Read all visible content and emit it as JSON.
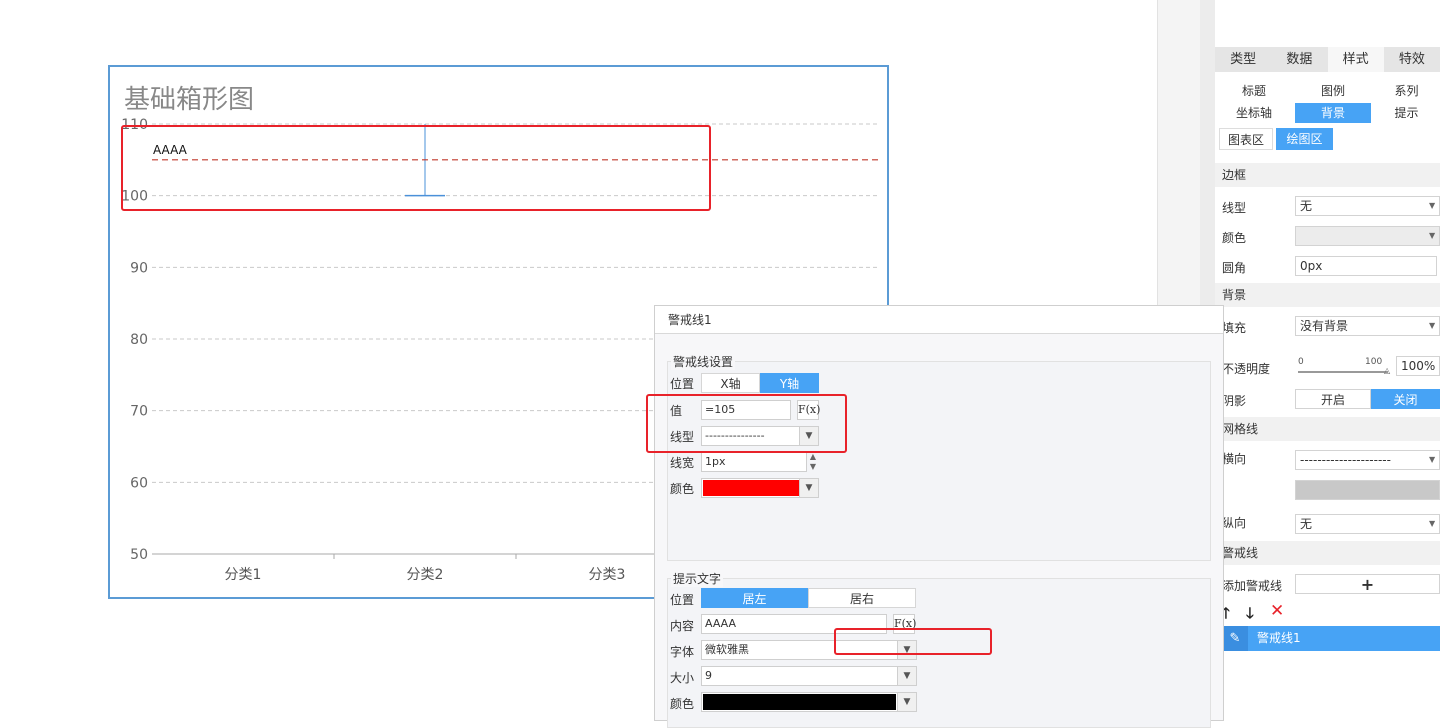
{
  "chart": {
    "title": "基础箱形图",
    "warning_label": "AAAA"
  },
  "chart_data": {
    "type": "box",
    "title": "基础箱形图",
    "categories": [
      "分类1",
      "分类2",
      "分类3"
    ],
    "y_ticks": [
      "110",
      "100",
      "90",
      "80",
      "70",
      "60",
      "50"
    ],
    "ylim": [
      50,
      110
    ],
    "grid": "horizontal-dashed",
    "series": [
      {
        "category": "分类2",
        "whisker_low": 100,
        "whisker_high": 110
      }
    ],
    "warning_line": {
      "value": 105,
      "label": "AAAA",
      "color": "#c0392b",
      "style": "dashed"
    }
  },
  "panel": {
    "main_tabs": [
      "类型",
      "数据",
      "样式",
      "特效"
    ],
    "sub_tabs_row1": [
      "标题",
      "图例",
      "系列"
    ],
    "sub_tabs_row2": [
      "坐标轴",
      "背景",
      "提示"
    ],
    "area_tabs": [
      "图表区",
      "绘图区"
    ],
    "border_section": "边框",
    "line_type_label": "线型",
    "line_type_value": "无",
    "color_label": "颜色",
    "corner_label": "圆角",
    "corner_value": "0px",
    "background_section": "背景",
    "fill_label": "填充",
    "fill_value": "没有背景",
    "opacity_label": "不透明度",
    "opacity_min": "0",
    "opacity_max": "100",
    "opacity_value": "100%",
    "shadow_label": "阴影",
    "shadow_on": "开启",
    "shadow_off": "关闭",
    "grid_section": "网格线",
    "horizontal_label": "横向",
    "horizontal_value": "---------------------",
    "vertical_label": "纵向",
    "vertical_value": "无",
    "warning_section": "警戒线",
    "add_warning_label": "添加警戒线",
    "add_symbol": "+",
    "warning_item": "警戒线1"
  },
  "dialog": {
    "title": "警戒线1",
    "settings_group": "警戒线设置",
    "position_label": "位置",
    "axis_x": "X轴",
    "axis_y": "Y轴",
    "value_label": "值",
    "value": "=105",
    "fx": "F(x)",
    "line_type_label": "线型",
    "line_type_value": "---------------",
    "line_width_label": "线宽",
    "line_width_value": "1px",
    "color_label": "颜色",
    "line_color": "#ff0000",
    "tip_group": "提示文字",
    "tip_position_label": "位置",
    "align_left": "居左",
    "align_right": "居右",
    "content_label": "内容",
    "content_value": "AAAA",
    "font_label": "字体",
    "font_value": "微软雅黑",
    "size_label": "大小",
    "size_value": "9",
    "text_color_label": "颜色",
    "text_color": "#000000"
  }
}
